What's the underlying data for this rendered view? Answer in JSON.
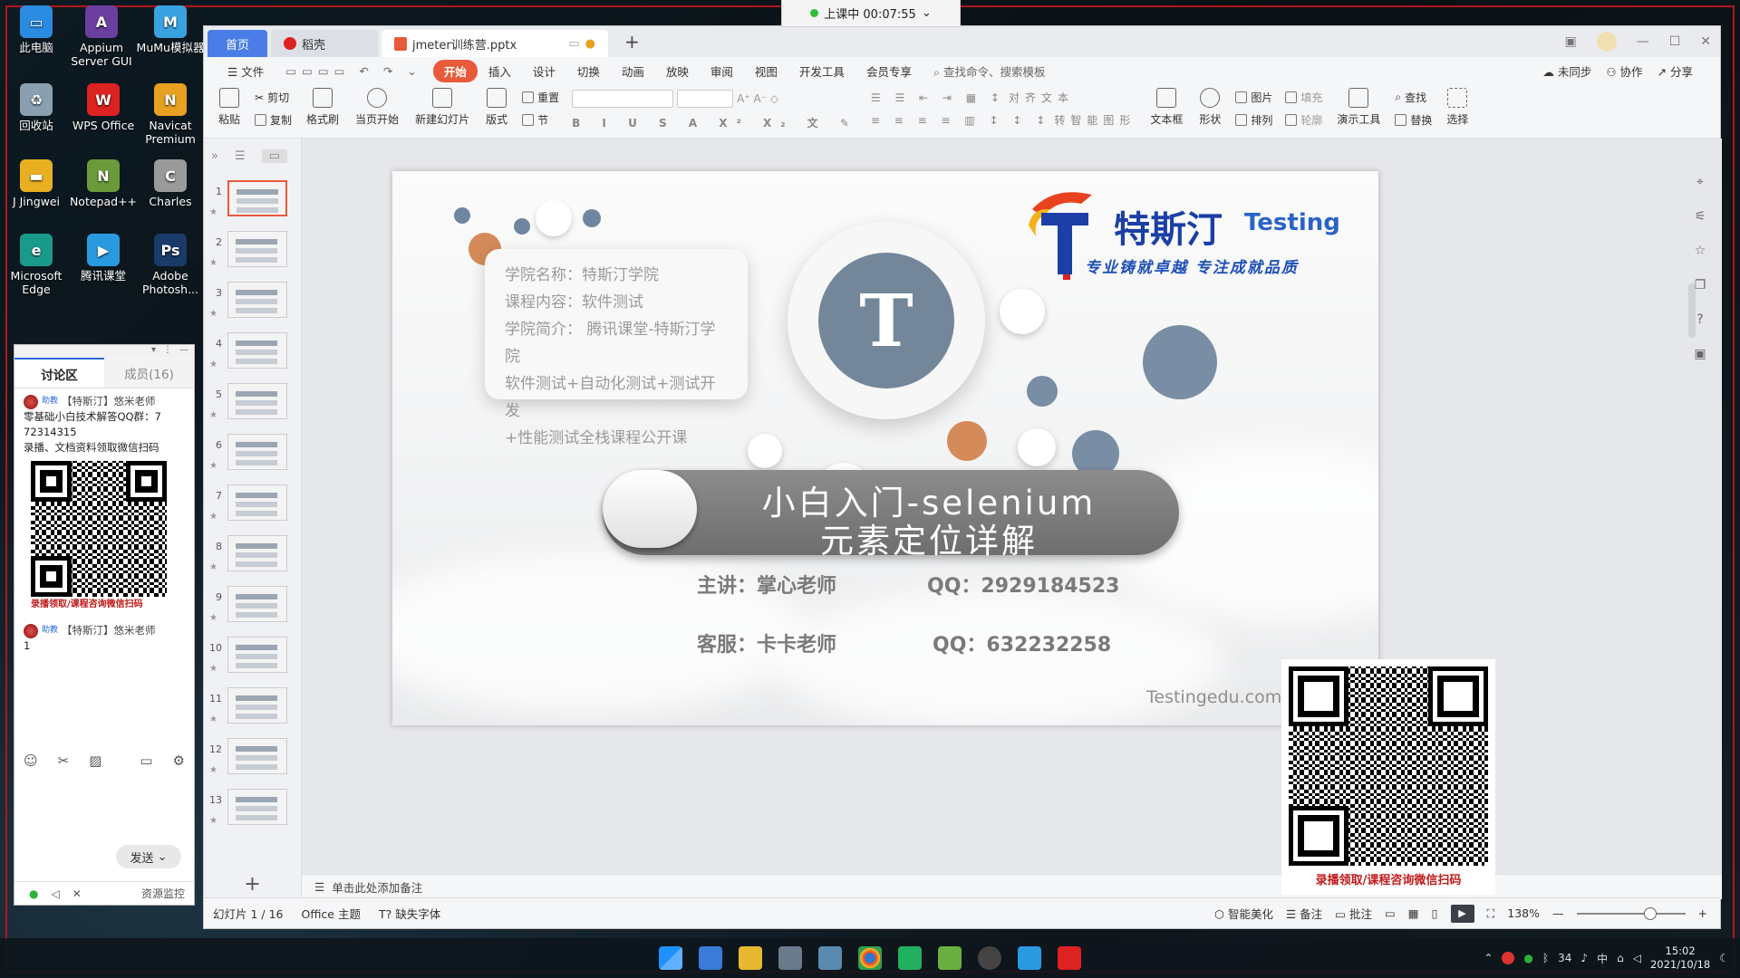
{
  "desktop": {
    "icons": [
      {
        "label": "此电脑",
        "color": "#2b8be0"
      },
      {
        "label": "Appium Server GUI",
        "color": "#6b3fa0"
      },
      {
        "label": "MuMu模拟器",
        "color": "#38a3e0"
      },
      {
        "label": "回收站",
        "color": "#8aa0b0"
      },
      {
        "label": "WPS Office",
        "color": "#d22"
      },
      {
        "label": "Navicat Premium",
        "color": "#e8a020"
      },
      {
        "label": "J Jingwei",
        "color": "#e8b020"
      },
      {
        "label": "Notepad++",
        "color": "#6a9a3a"
      },
      {
        "label": "Charles",
        "color": "#c8c8c8"
      },
      {
        "label": "Microsoft Edge",
        "color": "#1a9a8a"
      },
      {
        "label": "腾讯课堂",
        "color": "#2a9ae0"
      },
      {
        "label": "Adobe Photosh...",
        "color": "#1a3a6a"
      }
    ]
  },
  "live": {
    "status": "上课中 00:07:55"
  },
  "chat": {
    "tabs": [
      "讨论区",
      "成员(16)"
    ],
    "messages": [
      {
        "badge": "助教",
        "author": "【特斯汀】悠米老师",
        "lines": [
          "零基础小白技术解答QQ群：7",
          "72314315",
          "录播、文档资料领取微信扫码"
        ],
        "qr_caption": "录播领取/课程咨询微信扫码"
      },
      {
        "badge": "助教",
        "author": "【特斯汀】悠米老师",
        "lines": [
          "1"
        ]
      }
    ],
    "send_label": "发送",
    "footer_label": "资源监控"
  },
  "wps": {
    "tabs": {
      "home": "首页",
      "docer": "稻壳",
      "file": "jmeter训练营.pptx"
    },
    "menu": [
      "文件",
      "开始",
      "插入",
      "设计",
      "切换",
      "动画",
      "放映",
      "审阅",
      "视图",
      "开发工具",
      "会员专享"
    ],
    "search_label": "查找命令、搜索模板",
    "menu_right": [
      "未同步",
      "协作",
      "分享"
    ],
    "ribbon": {
      "paste": "粘贴",
      "cut": "剪切",
      "copy": "复制",
      "format_painter": "格式刷",
      "play_from": "当页开始",
      "new_slide": "新建幻灯片",
      "layout": "版式",
      "reset": "重置",
      "section": "节",
      "align_text": "对齐文本",
      "smart_graphic": "转智能图形",
      "textbox": "文本框",
      "shape": "形状",
      "picture": "图片",
      "arrange": "排列",
      "fill": "填充",
      "outline": "轮廓",
      "present_tools": "演示工具",
      "find": "查找",
      "replace": "替换",
      "select": "选择"
    },
    "slides_count": 13,
    "notes_placeholder": "单击此处添加备注",
    "status": {
      "slide_info": "幻灯片 1 / 16",
      "theme": "Office 主题",
      "missing_font": "缺失字体",
      "beautify": "智能美化",
      "notes": "备注",
      "comments": "批注",
      "zoom": "138%"
    }
  },
  "slide": {
    "info_lines": [
      "学院名称：特斯汀学院",
      "课程内容：软件测试",
      "学院简介：  腾讯课堂-特斯汀学院",
      "软件测试+自动化测试+测试开发",
      "+性能测试全栈课程公开课"
    ],
    "brand_zh": "特斯汀",
    "brand_en": "Testing",
    "slogan": "专业铸就卓越  专注成就品质",
    "title1": "小白入门-selenium",
    "title2": "元素定位详解",
    "lecturer": "主讲：掌心老师",
    "lecturer_qq": "QQ：2929184523",
    "service": "客服：卡卡老师",
    "service_qq": "QQ：632232258",
    "url": "Testingedu.com.cn"
  },
  "qr_overlay": {
    "caption": "录播领取/课程咨询微信扫码"
  },
  "taskbar": {
    "time": "15:02",
    "date": "2021/10/18",
    "lang": "中",
    "num": "34"
  }
}
